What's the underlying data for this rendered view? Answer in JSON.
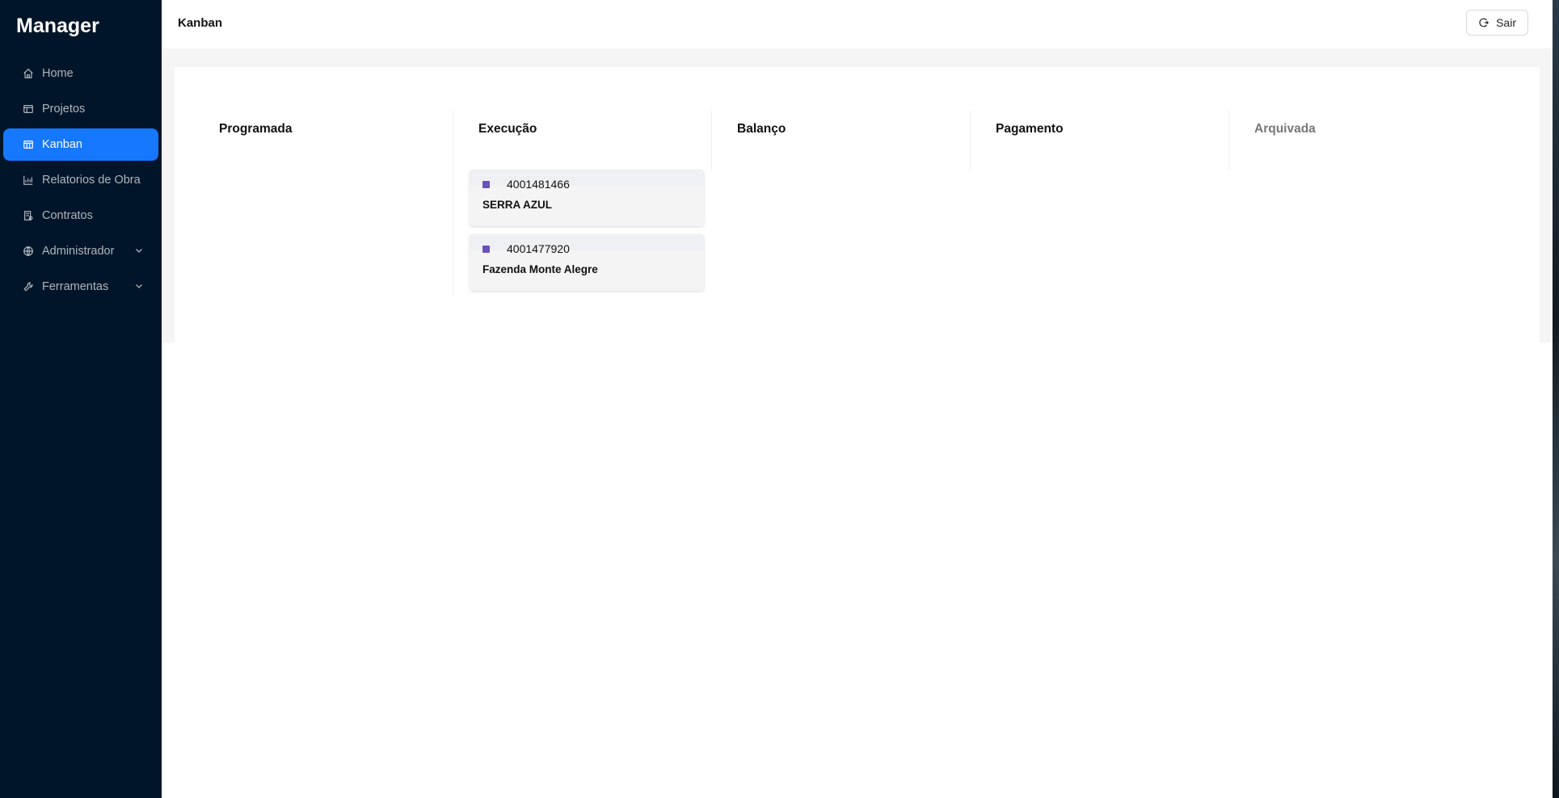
{
  "app": {
    "title": "Manager"
  },
  "sidebar": {
    "items": [
      {
        "label": "Home",
        "icon": "home-icon",
        "active": false
      },
      {
        "label": "Projetos",
        "icon": "projects-icon",
        "active": false
      },
      {
        "label": "Kanban",
        "icon": "kanban-icon",
        "active": true
      },
      {
        "label": "Relatorios de Obra",
        "icon": "chart-icon",
        "active": false
      },
      {
        "label": "Contratos",
        "icon": "contract-icon",
        "active": false
      },
      {
        "label": "Administrador",
        "icon": "globe-icon",
        "active": false,
        "expandable": true
      },
      {
        "label": "Ferramentas",
        "icon": "tool-icon",
        "active": false,
        "expandable": true
      }
    ]
  },
  "header": {
    "title": "Kanban",
    "logout_label": "Sair"
  },
  "board": {
    "columns": [
      {
        "title": "Programada",
        "cards": []
      },
      {
        "title": "Execução",
        "cards": [
          {
            "code": "4001481466",
            "name": "SERRA AZUL",
            "color": "#6b4fbb"
          },
          {
            "code": "4001477920",
            "name": "Fazenda Monte Alegre",
            "color": "#6b4fbb"
          }
        ]
      },
      {
        "title": "Balanço",
        "cards": []
      },
      {
        "title": "Pagamento",
        "cards": []
      },
      {
        "title": "Arquivada",
        "cards": []
      }
    ]
  },
  "colors": {
    "sidebar_bg": "#001529",
    "accent": "#1677ff",
    "card_marker": "#6b4fbb"
  }
}
